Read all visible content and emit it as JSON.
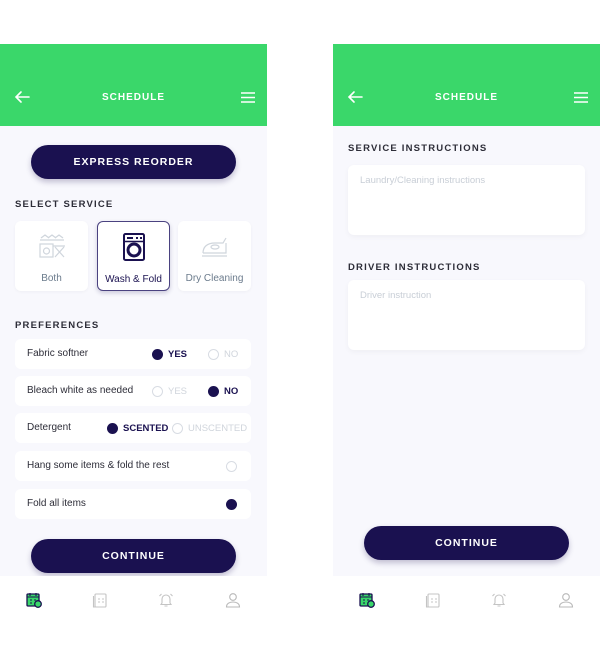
{
  "colors": {
    "header": "#3ad76a",
    "primary": "#1a1150",
    "background": "#f8f8fd"
  },
  "screen1": {
    "header": {
      "title": "SCHEDULE",
      "back_icon": "arrow-left-icon",
      "menu_icon": "hamburger-menu-icon"
    },
    "express_reorder_label": "EXPRESS REORDER",
    "select_service_label": "SELECT SERVICE",
    "services": [
      {
        "label": "Both",
        "icon": "hangers-washer-ironing-board-icon",
        "selected": false
      },
      {
        "label": "Wash & Fold",
        "icon": "washing-machine-icon",
        "selected": true
      },
      {
        "label": "Dry Cleaning",
        "icon": "iron-icon",
        "selected": false
      }
    ],
    "preferences_label": "PREFERENCES",
    "preferences": [
      {
        "label": "Fabric softner",
        "options": [
          {
            "label": "YES",
            "selected": true
          },
          {
            "label": "NO",
            "selected": false
          }
        ]
      },
      {
        "label": "Bleach white as needed",
        "options": [
          {
            "label": "YES",
            "selected": false
          },
          {
            "label": "NO",
            "selected": true
          }
        ]
      },
      {
        "label": "Detergent",
        "options": [
          {
            "label": "SCENTED",
            "selected": true
          },
          {
            "label": "UNSCENTED",
            "selected": false
          }
        ]
      },
      {
        "label": "Hang some items & fold the rest",
        "selected": false
      },
      {
        "label": "Fold all items",
        "selected": true
      }
    ],
    "continue_label": "CONTINUE"
  },
  "screen2": {
    "header": {
      "title": "SCHEDULE",
      "back_icon": "arrow-left-icon",
      "menu_icon": "hamburger-menu-icon"
    },
    "service_instructions_label": "SERVICE INSTRUCTIONS",
    "service_instructions_placeholder": "Laundry/Cleaning instructions",
    "service_instructions_value": "",
    "driver_instructions_label": "DRIVER INSTRUCTIONS",
    "driver_instructions_placeholder": "Driver instruction",
    "driver_instructions_value": "",
    "continue_label": "CONTINUE"
  },
  "navbar": [
    {
      "icon": "calendar-schedule-icon",
      "active": true
    },
    {
      "icon": "orders-list-icon",
      "active": false
    },
    {
      "icon": "bell-notification-icon",
      "active": false
    },
    {
      "icon": "user-profile-icon",
      "active": false
    }
  ]
}
